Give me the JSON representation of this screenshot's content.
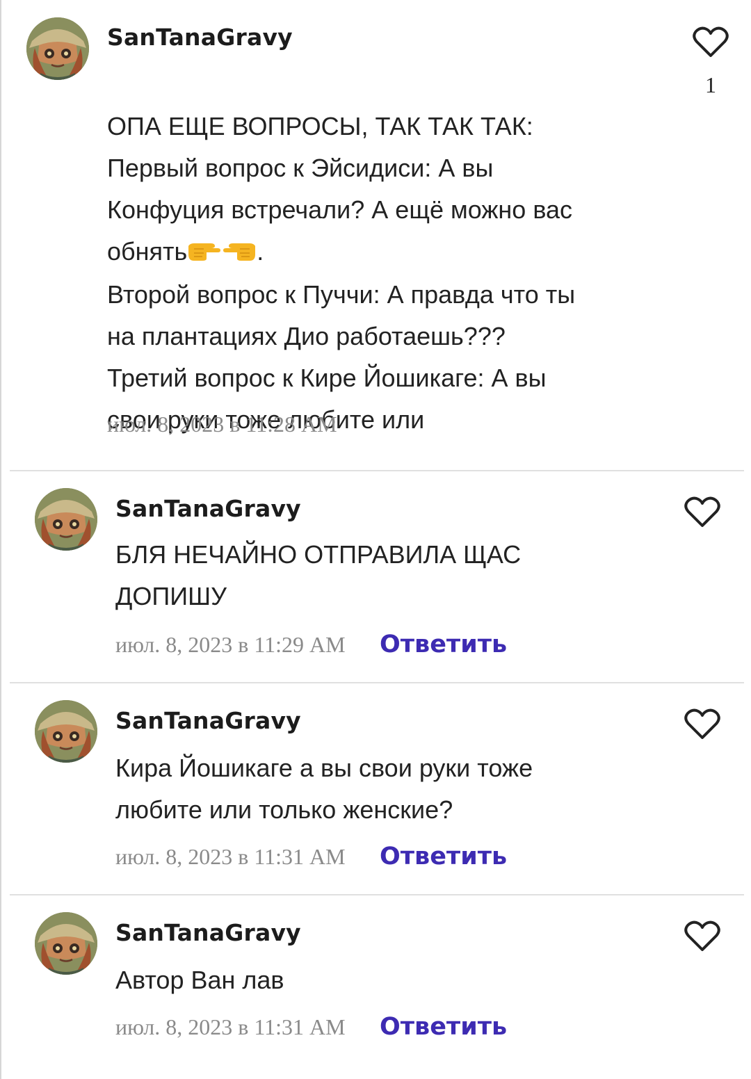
{
  "comments": [
    {
      "author": "SanTanaGravy",
      "lines_before_emoji": "ОПА ЕЩЕ ВОПРОСЫ, ТАК ТАК ТАК:\nПервый вопрос к Эйсидиси: А вы\nКонфуция встречали? А ещё можно вас\nобнять",
      "emoji_names": [
        "pointing-right-icon",
        "pointing-left-icon"
      ],
      "after_emoji": ".",
      "lines_after": "Второй вопрос к Пуччи: А правда что ты\nна плантациях Дио работаешь???\nТретий вопрос к Кире Йошикаге: А вы\nсвои руки тоже любите или",
      "timestamp": "июл. 8, 2023 в 11:28 AM",
      "likes": "1"
    },
    {
      "author": "SanTanaGravy",
      "text": "БЛЯ НЕЧАЙНО ОТПРАВИЛА ЩАС\nДОПИШУ",
      "timestamp": "июл. 8, 2023 в 11:29 AM",
      "reply_label": "Ответить"
    },
    {
      "author": "SanTanaGravy",
      "text": "Кира Йошикаге а вы свои руки тоже\nлюбите или только женские?",
      "timestamp": "июл. 8, 2023 в 11:31 AM",
      "reply_label": "Ответить"
    },
    {
      "author": "SanTanaGravy",
      "text": "Автор Ван лав",
      "timestamp": "июл. 8, 2023 в 11:31 AM",
      "reply_label": "Ответить"
    }
  ],
  "colors": {
    "reply_link": "#3d2bb2",
    "meta_text": "#8a8a8a",
    "divider": "#e0e0e0"
  }
}
